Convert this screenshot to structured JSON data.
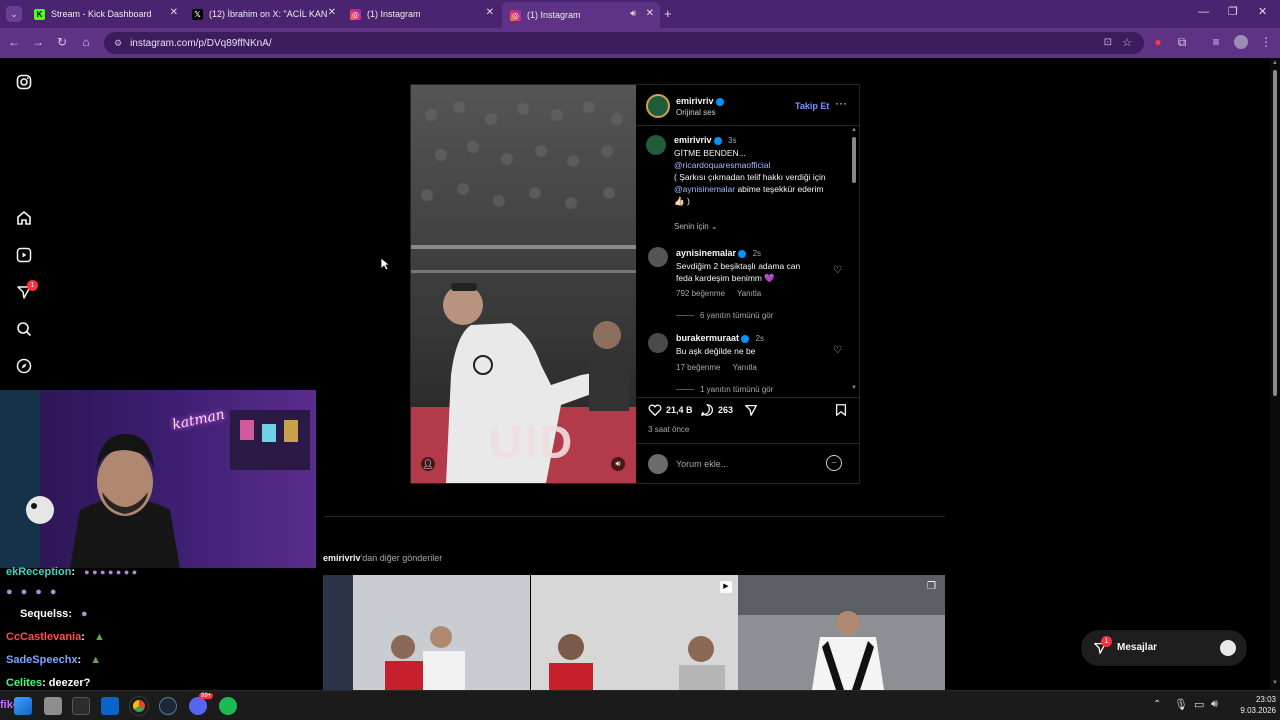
{
  "browser": {
    "tabs": [
      {
        "title": "Stream - Kick Dashboard",
        "icon": "kick-icon",
        "icon_color": "#53fc18",
        "active": false
      },
      {
        "title": "(12) İbrahim on X: \"ACİL KAN İh",
        "icon": "x-icon",
        "icon_color": "#000000",
        "active": false
      },
      {
        "title": "(1) Instagram",
        "icon": "instagram-icon",
        "icon_color": "#e1306c",
        "active": false
      },
      {
        "title": "(1) Instagram",
        "icon": "instagram-icon",
        "icon_color": "#e1306c",
        "active": true
      }
    ],
    "url": "instagram.com/p/DVq89ffNKnA/"
  },
  "sidebar": {
    "notification_badge": "1"
  },
  "post": {
    "author": "emirivriv",
    "audio": "Orijinal ses",
    "follow_label": "Takip Et",
    "caption": {
      "author": "emirivriv",
      "time": "3s",
      "line1": "GİTME BENDEN...",
      "mention1": "@ricardoquaresmaofficial",
      "line2": "( Şarkısı çıkmadan telif hakkı verdiği için",
      "mention2": "@aynisinemalar",
      "line3": " abime teşekkür ederim",
      "line4": "👍🏻 )"
    },
    "filter_label": "Senin için",
    "comments": [
      {
        "author": "aynisinemalar",
        "time": "2s",
        "text": "Sevdiğim 2 beşiktaşlı adama can feda kardeşim benimm 💜",
        "likes": "792 beğenme",
        "reply": "Yanıtla",
        "view_replies": "6 yanıtın tümünü gör"
      },
      {
        "author": "burakermuraat",
        "time": "2s",
        "text": "Bu aşk değilde ne be",
        "likes": "17 beğenme",
        "reply": "Yanıtla",
        "view_replies": "1 yanıtın tümünü gör"
      }
    ],
    "like_count": "21,4 B",
    "comment_count": "263",
    "posted_ago": "3 saat önce",
    "comment_placeholder": "Yorum ekle...",
    "video_overlay_text": "UID"
  },
  "more_from": {
    "author": "emirivriv",
    "suffix": "'dan diğer gönderiler"
  },
  "messages": {
    "label": "Mesajlar",
    "badge": "1"
  },
  "stream": {
    "neon_sign": "katman",
    "chat": [
      {
        "user": "ekReception",
        "color": "#3fd3c6",
        "msg": ":"
      },
      {
        "user": "Sequelss",
        "color": "#ffffff",
        "msg": ":"
      },
      {
        "user": "CcCastlevania",
        "color": "#ff4d4d",
        "msg": ":"
      },
      {
        "user": "SadeSpeechx",
        "color": "#7aa7ff",
        "msg": ":"
      },
      {
        "user": "Celites",
        "color": "#3dff7a",
        "msg": ": deezer?"
      },
      {
        "user": "fikeliy",
        "color": "#c86cff",
        "msg": ":"
      }
    ]
  },
  "taskbar": {
    "time": "23:03",
    "date": "9.03.2026",
    "discord_badge": "99+"
  }
}
